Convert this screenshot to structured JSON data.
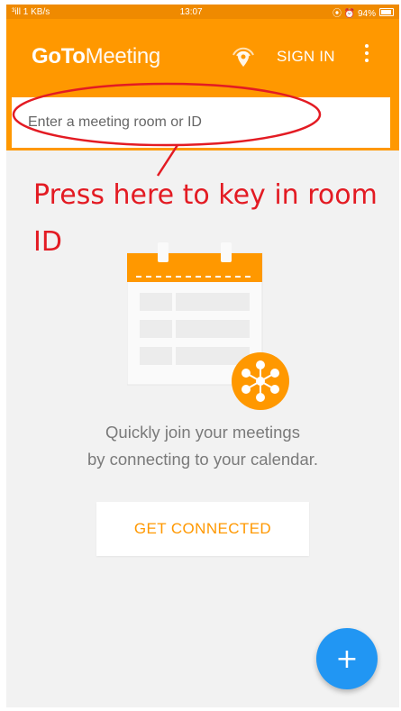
{
  "status_bar": {
    "left": "³ill 1 KB/s",
    "time": "13:07",
    "right": "⦿ ⏰ 94%"
  },
  "app_bar": {
    "brand_bold": "GoTo",
    "brand_light": "Meeting",
    "sign_in_label": "SIGN IN",
    "search_placeholder": "Enter a meeting room or ID"
  },
  "annotation": {
    "text": "Press here to key in room ID"
  },
  "empty_state": {
    "line1": "Quickly join your meetings",
    "line2": "by connecting to your calendar.",
    "cta_label": "GET CONNECTED"
  },
  "fab": {
    "label": "+"
  },
  "colors": {
    "primary": "#ff9800",
    "status_bar": "#ef8a00",
    "background": "#f2f2f2",
    "annotation_red": "#e31b23",
    "fab_blue": "#2196f3"
  }
}
